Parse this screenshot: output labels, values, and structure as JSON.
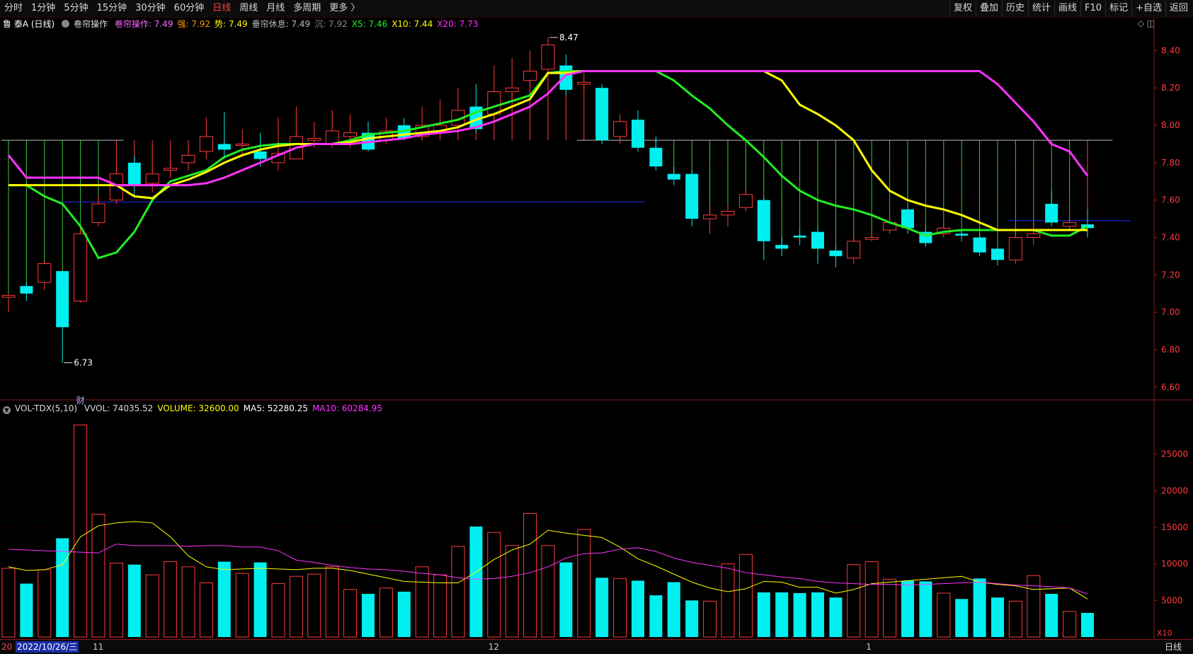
{
  "periods": [
    {
      "label": "分时",
      "active": false
    },
    {
      "label": "1分钟",
      "active": false
    },
    {
      "label": "5分钟",
      "active": false
    },
    {
      "label": "15分钟",
      "active": false
    },
    {
      "label": "30分钟",
      "active": false
    },
    {
      "label": "60分钟",
      "active": false
    },
    {
      "label": "日线",
      "active": true
    },
    {
      "label": "周线",
      "active": false
    },
    {
      "label": "月线",
      "active": false
    },
    {
      "label": "多周期",
      "active": false
    },
    {
      "label": "更多 〉",
      "active": false
    }
  ],
  "tools": [
    "复权",
    "叠加",
    "历史",
    "统计",
    "画线",
    "F10",
    "标记",
    "+自选",
    "返回"
  ],
  "price_legend": {
    "stock": "鲁 泰A (日线)",
    "indicator": "卷帘操作",
    "items": [
      {
        "text": "卷帘操作: 7.49",
        "color": "#ff66ff"
      },
      {
        "text": "强: 7.92",
        "color": "#ff9900"
      },
      {
        "text": "势: 7.49",
        "color": "#ffff00"
      },
      {
        "text": "垂帘休息: 7.49",
        "color": "#bbbbbb"
      },
      {
        "text": "沉: 7.92",
        "color": "#888888"
      },
      {
        "text": "X5: 7.46",
        "color": "#22ee22"
      },
      {
        "text": "X10: 7.44",
        "color": "#ffff00"
      },
      {
        "text": "X20: 7.73",
        "color": "#ff33ff"
      }
    ]
  },
  "vol_legend": {
    "indicator": "VOL-TDX(5,10)",
    "items": [
      {
        "text": "VVOL: 74035.52",
        "color": "#dddddd"
      },
      {
        "text": "VOLUME: 32600.00",
        "color": "#ffff00"
      },
      {
        "text": "MA5: 52280.25",
        "color": "#ffffff"
      },
      {
        "text": "MA10: 60284.95",
        "color": "#ff33ff"
      }
    ]
  },
  "date_bar": {
    "current": "2022/10/26/三",
    "months": [
      {
        "label": "11",
        "idx": 5
      },
      {
        "label": "12",
        "idx": 27
      },
      {
        "label": "1",
        "idx": 48
      }
    ],
    "tab": "日线",
    "first_label": "20"
  },
  "corner_label": "X10",
  "finance_marker": "财",
  "chart_data": {
    "type": "candlestick",
    "price_ylim": [
      6.55,
      8.5
    ],
    "price_ticks": [
      6.6,
      6.8,
      7.0,
      7.2,
      7.4,
      7.6,
      7.8,
      8.0,
      8.2,
      8.4
    ],
    "vol_ylim": [
      0,
      30000
    ],
    "vol_ticks": [
      5000,
      10000,
      15000,
      20000,
      25000
    ],
    "annotations": [
      {
        "text": "8.47",
        "idx": 30,
        "price": 8.47
      },
      {
        "text": "6.73",
        "idx": 3,
        "price": 6.73
      }
    ],
    "candles": [
      [
        7.08,
        7.09,
        7.0,
        7.1
      ],
      [
        7.14,
        7.1,
        7.06,
        7.16
      ],
      [
        7.16,
        7.26,
        7.12,
        7.28
      ],
      [
        7.22,
        6.92,
        6.73,
        7.22
      ],
      [
        7.06,
        7.42,
        7.05,
        7.45
      ],
      [
        7.48,
        7.58,
        7.46,
        7.62
      ],
      [
        7.6,
        7.74,
        7.58,
        7.78
      ],
      [
        7.8,
        7.68,
        7.62,
        7.84
      ],
      [
        7.69,
        7.74,
        7.64,
        7.78
      ],
      [
        7.76,
        7.77,
        7.72,
        7.82
      ],
      [
        7.8,
        7.84,
        7.76,
        7.88
      ],
      [
        7.86,
        7.94,
        7.82,
        8.04
      ],
      [
        7.9,
        7.87,
        7.82,
        8.07
      ],
      [
        7.9,
        7.9,
        7.84,
        7.98
      ],
      [
        7.86,
        7.82,
        7.78,
        7.96
      ],
      [
        7.8,
        7.85,
        7.76,
        8.04
      ],
      [
        7.82,
        7.94,
        7.82,
        8.1
      ],
      [
        7.92,
        7.93,
        7.88,
        8.02
      ],
      [
        7.9,
        7.97,
        7.88,
        8.08
      ],
      [
        7.94,
        7.96,
        7.88,
        8.06
      ],
      [
        7.96,
        7.87,
        7.86,
        8.02
      ],
      [
        7.92,
        7.97,
        7.9,
        8.04
      ],
      [
        8.0,
        7.93,
        7.92,
        8.04
      ],
      [
        7.94,
        8.0,
        7.92,
        8.1
      ],
      [
        7.96,
        8.0,
        7.94,
        8.14
      ],
      [
        8.0,
        8.08,
        7.96,
        8.2
      ],
      [
        8.1,
        7.98,
        7.96,
        8.22
      ],
      [
        8.06,
        8.18,
        8.02,
        8.32
      ],
      [
        8.18,
        8.2,
        8.14,
        8.36
      ],
      [
        8.24,
        8.29,
        8.2,
        8.4
      ],
      [
        8.3,
        8.43,
        8.28,
        8.47
      ],
      [
        8.32,
        8.19,
        8.16,
        8.38
      ],
      [
        8.22,
        8.23,
        8.18,
        8.28
      ],
      [
        8.2,
        7.92,
        7.9,
        8.22
      ],
      [
        7.94,
        8.02,
        7.9,
        8.06
      ],
      [
        8.03,
        7.88,
        7.86,
        8.08
      ],
      [
        7.88,
        7.78,
        7.76,
        7.94
      ],
      [
        7.74,
        7.71,
        7.68,
        7.78
      ],
      [
        7.74,
        7.5,
        7.46,
        7.76
      ],
      [
        7.5,
        7.52,
        7.42,
        7.58
      ],
      [
        7.52,
        7.54,
        7.46,
        7.58
      ],
      [
        7.56,
        7.63,
        7.54,
        7.66
      ],
      [
        7.6,
        7.38,
        7.28,
        7.62
      ],
      [
        7.36,
        7.34,
        7.3,
        7.4
      ],
      [
        7.41,
        7.4,
        7.36,
        7.44
      ],
      [
        7.43,
        7.34,
        7.26,
        7.46
      ],
      [
        7.33,
        7.3,
        7.24,
        7.36
      ],
      [
        7.29,
        7.38,
        7.26,
        7.42
      ],
      [
        7.39,
        7.4,
        7.38,
        7.44
      ],
      [
        7.44,
        7.48,
        7.42,
        7.52
      ],
      [
        7.55,
        7.45,
        7.42,
        7.58
      ],
      [
        7.43,
        7.37,
        7.35,
        7.46
      ],
      [
        7.42,
        7.45,
        7.4,
        7.48
      ],
      [
        7.42,
        7.41,
        7.38,
        7.44
      ],
      [
        7.4,
        7.32,
        7.3,
        7.42
      ],
      [
        7.34,
        7.28,
        7.25,
        7.36
      ],
      [
        7.28,
        7.4,
        7.26,
        7.46
      ],
      [
        7.4,
        7.42,
        7.36,
        7.48
      ],
      [
        7.58,
        7.48,
        7.46,
        7.65
      ],
      [
        7.46,
        7.48,
        7.44,
        7.61
      ],
      [
        7.47,
        7.45,
        7.4,
        7.55
      ]
    ],
    "volumes": [
      9400,
      7300,
      9200,
      13500,
      29000,
      16800,
      10100,
      9900,
      8500,
      10300,
      9600,
      7400,
      10300,
      8700,
      10200,
      7300,
      8300,
      8600,
      9600,
      6500,
      5900,
      6700,
      6200,
      9600,
      8500,
      12400,
      15100,
      14300,
      12500,
      16900,
      12500,
      10200,
      14700,
      8100,
      8000,
      7700,
      5700,
      7500,
      5000,
      4900,
      10000,
      11300,
      6100,
      6100,
      6000,
      6100,
      5400,
      9900,
      10300,
      7900,
      7700,
      7600,
      6000,
      5200,
      8000,
      5400,
      4900,
      8400,
      5900,
      3500,
      3300
    ],
    "series": [
      {
        "name": "X5",
        "color": "#22ee22",
        "values": [
          7.68,
          7.68,
          7.62,
          7.58,
          7.46,
          7.29,
          7.32,
          7.43,
          7.6,
          7.7,
          7.73,
          7.76,
          7.83,
          7.87,
          7.89,
          7.9,
          7.9,
          7.9,
          7.9,
          7.92,
          7.95,
          7.96,
          7.97,
          7.99,
          8.01,
          8.03,
          8.07,
          8.1,
          8.13,
          8.16,
          8.28,
          8.29,
          8.29,
          8.29,
          8.29,
          8.29,
          8.29,
          8.24,
          8.16,
          8.09,
          8.0,
          7.92,
          7.83,
          7.73,
          7.65,
          7.6,
          7.57,
          7.55,
          7.52,
          7.48,
          7.45,
          7.41,
          7.43,
          7.44,
          7.44,
          7.44,
          7.44,
          7.44,
          7.41,
          7.41,
          7.46
        ]
      },
      {
        "name": "X10",
        "color": "#ffff00",
        "values": [
          7.68,
          7.68,
          7.68,
          7.68,
          7.68,
          7.68,
          7.68,
          7.62,
          7.61,
          7.68,
          7.71,
          7.75,
          7.8,
          7.84,
          7.87,
          7.89,
          7.9,
          7.9,
          7.9,
          7.91,
          7.93,
          7.94,
          7.95,
          7.96,
          7.97,
          7.99,
          8.03,
          8.06,
          8.1,
          8.14,
          8.28,
          8.28,
          8.29,
          8.29,
          8.29,
          8.29,
          8.29,
          8.29,
          8.29,
          8.29,
          8.29,
          8.29,
          8.29,
          8.24,
          8.11,
          8.06,
          8.0,
          7.92,
          7.76,
          7.65,
          7.6,
          7.57,
          7.55,
          7.52,
          7.48,
          7.44,
          7.44,
          7.44,
          7.44,
          7.44,
          7.44
        ]
      },
      {
        "name": "X20",
        "color": "#ff33ff",
        "values": [
          7.84,
          7.72,
          7.72,
          7.72,
          7.72,
          7.72,
          7.68,
          7.68,
          7.68,
          7.68,
          7.68,
          7.69,
          7.72,
          7.76,
          7.8,
          7.84,
          7.88,
          7.9,
          7.9,
          7.9,
          7.91,
          7.92,
          7.93,
          7.95,
          7.96,
          7.97,
          7.99,
          8.02,
          8.06,
          8.1,
          8.17,
          8.27,
          8.29,
          8.29,
          8.29,
          8.29,
          8.29,
          8.29,
          8.29,
          8.29,
          8.29,
          8.29,
          8.29,
          8.29,
          8.29,
          8.29,
          8.29,
          8.29,
          8.29,
          8.29,
          8.29,
          8.29,
          8.29,
          8.29,
          8.29,
          8.22,
          8.12,
          8.02,
          7.9,
          7.86,
          7.73
        ]
      }
    ],
    "vol_series": [
      {
        "name": "MA5",
        "color": "#ffff00",
        "values": [
          9600,
          9100,
          9200,
          9900,
          13700,
          15200,
          15600,
          15800,
          15600,
          13700,
          11100,
          9600,
          9200,
          9300,
          9400,
          9300,
          9200,
          9400,
          9400,
          9100,
          8600,
          8100,
          7600,
          7500,
          7400,
          7400,
          8900,
          10600,
          11900,
          12700,
          14600,
          14200,
          13900,
          13600,
          12300,
          10700,
          9700,
          8600,
          7500,
          6700,
          6200,
          6600,
          7600,
          7500,
          6800,
          6800,
          6000,
          6500,
          7300,
          7500,
          7700,
          7900,
          8100,
          8300,
          7500,
          7200,
          7000,
          6500,
          6600,
          6700,
          5200
        ]
      },
      {
        "name": "MA10",
        "color": "#ff33ff",
        "values": [
          12000,
          11900,
          11800,
          11700,
          11600,
          11500,
          12700,
          12500,
          12500,
          12500,
          12400,
          12500,
          12500,
          12300,
          12300,
          11800,
          10500,
          10200,
          9800,
          9500,
          9300,
          9200,
          9000,
          8700,
          8500,
          8100,
          7900,
          8000,
          8300,
          8800,
          9600,
          10800,
          11400,
          11500,
          12000,
          12200,
          11700,
          10800,
          10200,
          9800,
          9400,
          8800,
          8500,
          8200,
          8000,
          7600,
          7400,
          7300,
          7200,
          7200,
          7100,
          7200,
          7300,
          7400,
          7500,
          7300,
          7100,
          7000,
          6900,
          6700,
          5900
        ]
      }
    ],
    "hlines": [
      {
        "price": 7.92,
        "from": 0,
        "to": 6,
        "color": "#b8b8b8"
      },
      {
        "price": 7.92,
        "from": 32,
        "to": 61,
        "color": "#b8b8b8"
      },
      {
        "price": 7.59,
        "from": 3,
        "to": 35,
        "color": "#2030ff"
      },
      {
        "price": 7.49,
        "from": 56,
        "to": 62,
        "color": "#2030ff"
      }
    ]
  }
}
